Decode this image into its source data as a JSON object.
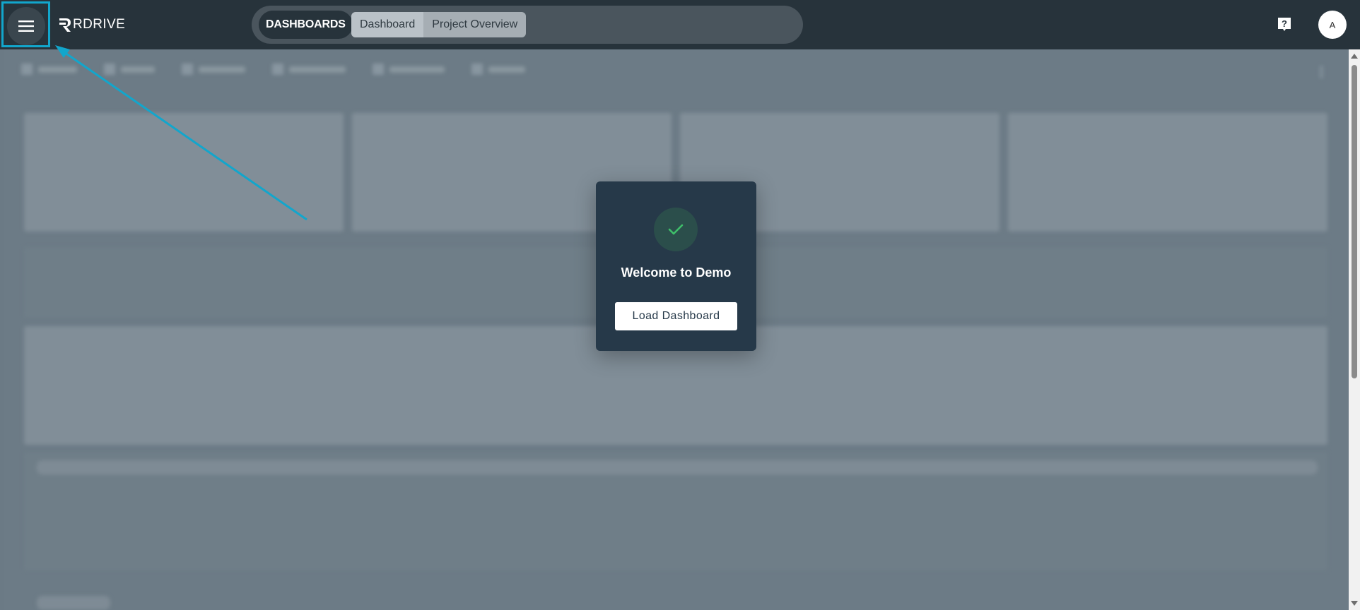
{
  "header": {
    "logo_text": "RDRIVE",
    "dashboards_label": "DASHBOARDS",
    "tabs": [
      {
        "label": "Dashboard",
        "active": true
      },
      {
        "label": "Project Overview",
        "active": false
      }
    ],
    "help_icon": "help-question-icon",
    "avatar_initial": "A"
  },
  "modal": {
    "icon": "check-icon",
    "title": "Welcome to Demo",
    "button_label": "Load Dashboard"
  },
  "colors": {
    "topbar": "#27333b",
    "modal_bg": "#263949",
    "check_green": "#3fbf6a",
    "highlight": "#12a6cc"
  }
}
